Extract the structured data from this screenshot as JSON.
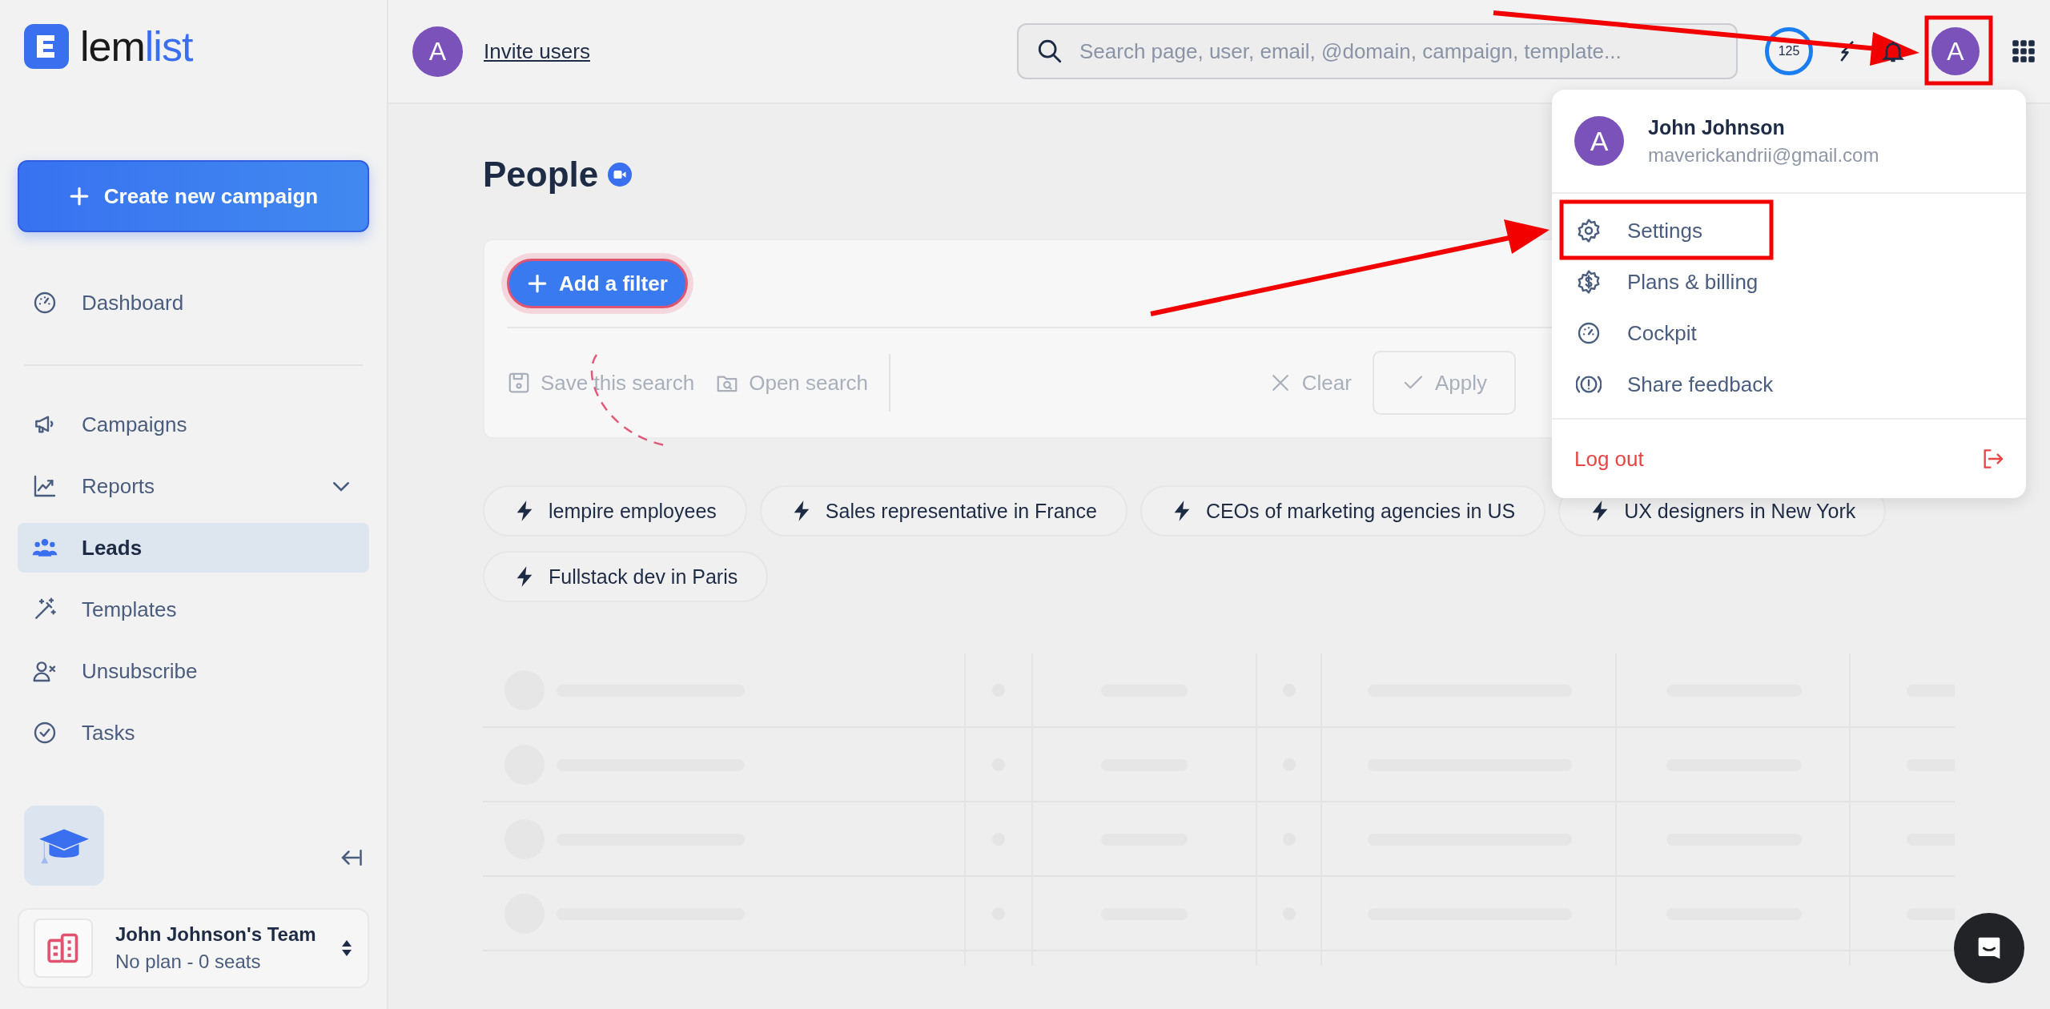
{
  "logo": {
    "lead": "lem",
    "accent": "list"
  },
  "sidebar": {
    "create_button": "Create new campaign",
    "primary": [
      {
        "label": "Dashboard",
        "selected": false,
        "submenu": false
      }
    ],
    "items": [
      {
        "label": "Campaigns",
        "selected": false,
        "submenu": false
      },
      {
        "label": "Reports",
        "selected": false,
        "submenu": true
      },
      {
        "label": "Leads",
        "selected": true,
        "submenu": false
      },
      {
        "label": "Templates",
        "selected": false,
        "submenu": false
      },
      {
        "label": "Unsubscribe",
        "selected": false,
        "submenu": false
      },
      {
        "label": "Tasks",
        "selected": false,
        "submenu": false
      }
    ],
    "team": {
      "name": "John Johnson's Team",
      "plan": "No plan - 0 seats"
    }
  },
  "header": {
    "avatar": "A",
    "invite": "Invite users",
    "search": {
      "placeholder": "Search page, user, email, @domain, campaign, template..."
    },
    "credits": "125",
    "user_avatar": "A"
  },
  "page": {
    "title": "People",
    "add_filter": "Add a filter",
    "actions": [
      {
        "label": "Save this search",
        "kind": "link",
        "disabled": true
      },
      {
        "label": "Open search",
        "kind": "link",
        "disabled": true
      },
      {
        "label": "Clear",
        "kind": "link",
        "disabled": true
      },
      {
        "label": "Apply",
        "kind": "button",
        "disabled": true
      }
    ],
    "chips": [
      "lempire employees",
      "Sales representative in France",
      "CEOs of marketing agencies in US",
      "UX designers in New York",
      "Fullstack dev in Paris"
    ]
  },
  "user_menu": {
    "avatar": "A",
    "name": "John Johnson",
    "email": "maverickandrii@gmail.com",
    "items": [
      "Settings",
      "Plans & billing",
      "Cockpit",
      "Share feedback"
    ],
    "logout": "Log out"
  }
}
